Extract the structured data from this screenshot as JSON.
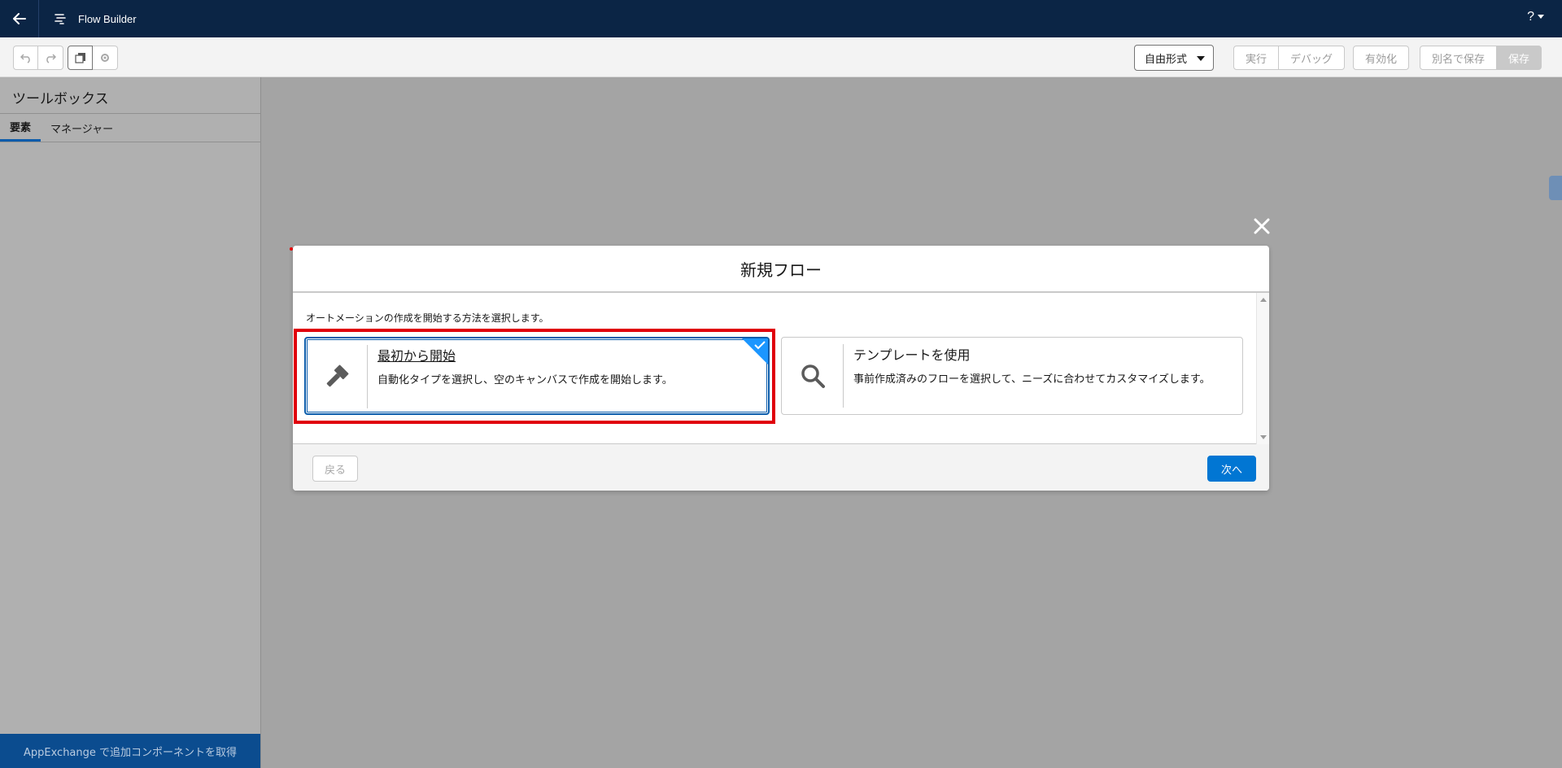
{
  "header": {
    "app_title": "Flow Builder",
    "help_label": "?"
  },
  "toolbar": {
    "mode_select_value": "自由形式",
    "run_label": "実行",
    "debug_label": "デバッグ",
    "activate_label": "有効化",
    "save_as_label": "別名で保存",
    "save_label": "保存"
  },
  "toolbox": {
    "title": "ツールボックス",
    "tabs": [
      {
        "label": "要素",
        "active": true
      },
      {
        "label": "マネージャー",
        "active": false
      }
    ],
    "appexchange_label": "AppExchange で追加コンポーネントを取得"
  },
  "modal": {
    "title": "新規フロー",
    "description": "オートメーションの作成を開始する方法を選択します。",
    "options": [
      {
        "title": "最初から開始",
        "description": "自動化タイプを選択し、空のキャンバスで作成を開始します。",
        "icon": "hammer-icon",
        "selected": true
      },
      {
        "title": "テンプレートを使用",
        "description": "事前作成済みのフローを選択して、ニーズに合わせてカスタマイズします。",
        "icon": "search-icon",
        "selected": false
      }
    ],
    "back_label": "戻る",
    "next_label": "次へ"
  },
  "colors": {
    "header_bg": "#0b2545",
    "brand_blue": "#0176d3",
    "highlight_red": "#e0000a",
    "selected_corner": "#1b96ff"
  }
}
